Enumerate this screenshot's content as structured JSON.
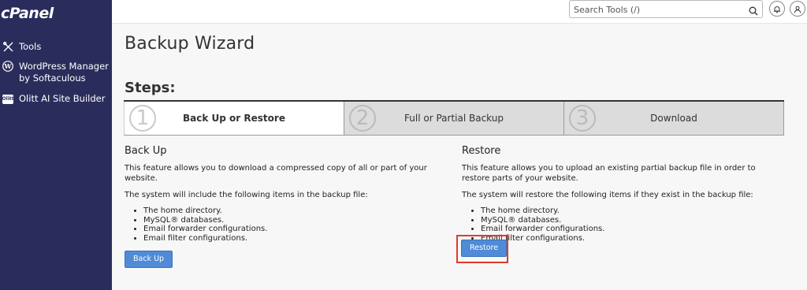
{
  "app": {
    "logo": "cPanel"
  },
  "sidebar": {
    "items": [
      {
        "label": "Tools",
        "icon": "tools-icon"
      },
      {
        "label": "WordPress Manager by Softaculous",
        "line1": "WordPress Manager",
        "line2": "by Softaculous",
        "icon": "wordpress-icon"
      },
      {
        "label": "Olitt AI Site Builder",
        "icon": "olitt-icon",
        "badge": "Olitt"
      }
    ]
  },
  "search": {
    "placeholder": "Search Tools (/)"
  },
  "page": {
    "title": "Backup Wizard",
    "steps_title": "Steps:"
  },
  "steps": [
    {
      "num": "1",
      "label": "Back Up or Restore",
      "active": true
    },
    {
      "num": "2",
      "label": "Full or Partial Backup",
      "active": false
    },
    {
      "num": "3",
      "label": "Download",
      "active": false
    }
  ],
  "backup": {
    "heading": "Back Up",
    "desc": "This feature allows you to download a compressed copy of all or part of your website.",
    "intro": "The system will include the following items in the backup file:",
    "items": [
      "The home directory.",
      "MySQL® databases.",
      "Email forwarder configurations.",
      "Email filter configurations."
    ],
    "button": "Back Up"
  },
  "restore": {
    "heading": "Restore",
    "desc": "This feature allows you to upload an existing partial backup file in order to restore parts of your website.",
    "intro": "The system will restore the following items if they exist in the backup file:",
    "items": [
      "The home directory.",
      "MySQL® databases.",
      "Email forwarder configurations.",
      "Email filter configurations."
    ],
    "button": "Restore"
  },
  "colors": {
    "sidebar": "#2a2d5c",
    "button": "#4f8bd6",
    "highlight": "#e13b2c"
  }
}
